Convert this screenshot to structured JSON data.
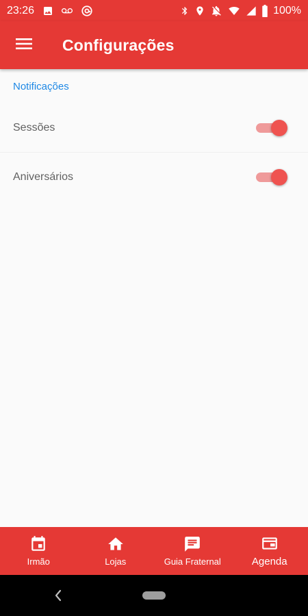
{
  "status_bar": {
    "time": "23:26",
    "battery": "100%",
    "left_icons": [
      "image-icon",
      "voicemail-icon",
      "at-sign-icon"
    ],
    "right_icons": [
      "bluetooth-icon",
      "location-icon",
      "alarm-off-icon",
      "wifi-icon",
      "signal-icon",
      "battery-icon"
    ]
  },
  "app_bar": {
    "title": "Configurações",
    "menu_icon": "menu-icon"
  },
  "notifications": {
    "section_title": "Notificações",
    "items": [
      {
        "label": "Sessões",
        "enabled": true
      },
      {
        "label": "Aniversários",
        "enabled": true
      }
    ]
  },
  "bottom_nav": {
    "items": [
      {
        "label": "Irmão",
        "icon": "calendar-icon"
      },
      {
        "label": "Lojas",
        "icon": "home-icon"
      },
      {
        "label": "Guia Fraternal",
        "icon": "message-icon"
      },
      {
        "label": "Agenda",
        "icon": "agenda-icon"
      }
    ]
  },
  "colors": {
    "primary": "#e53935",
    "accent_text": "#1e88e5",
    "toggle_thumb": "#ef5350",
    "toggle_track": "#ef9a9a"
  }
}
